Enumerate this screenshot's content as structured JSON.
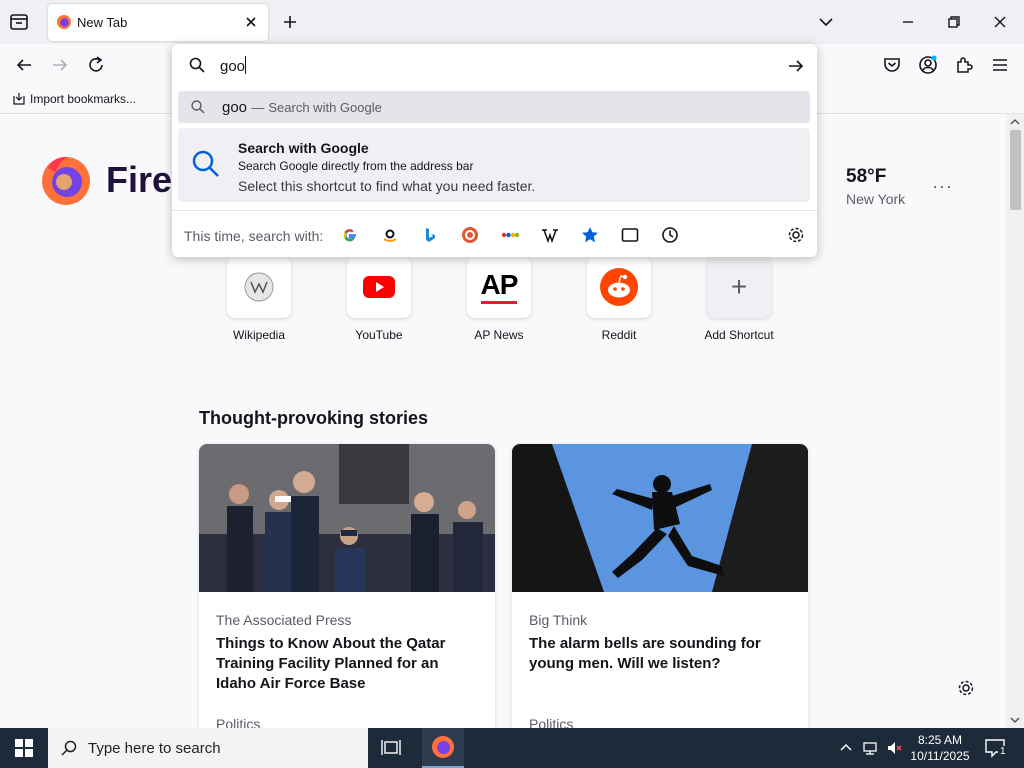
{
  "tabs": [
    {
      "title": "New Tab",
      "active": true
    }
  ],
  "bookmarks": {
    "import_label": "Import bookmarks..."
  },
  "urlbar": {
    "value": "goo",
    "suggestion": {
      "query": "goo",
      "separator": "—",
      "action": "Search with Google"
    },
    "tip": {
      "title": "Search with Google",
      "line1": "Search Google directly from the address bar",
      "line2": "Select this shortcut to find what you need faster."
    },
    "engines_label": "This time, search with:",
    "engines": [
      "google-icon",
      "amazon-icon",
      "bing-icon",
      "duckduckgo-icon",
      "ebay-icon",
      "wikipedia-icon",
      "bookmarks-icon",
      "tabs-icon",
      "history-icon"
    ]
  },
  "brand": {
    "name": "Firef"
  },
  "weather": {
    "temp": "58°F",
    "city": "New York",
    "more": "···"
  },
  "shortcuts": [
    {
      "label": "Wikipedia",
      "icon": "wikipedia-icon"
    },
    {
      "label": "YouTube",
      "icon": "youtube-icon"
    },
    {
      "label": "AP News",
      "icon": "ap-icon",
      "text": "AP"
    },
    {
      "label": "Reddit",
      "icon": "reddit-icon"
    },
    {
      "label": "Add Shortcut",
      "icon": "plus-icon",
      "text": "+"
    }
  ],
  "stories": {
    "section_title": "Thought-provoking stories",
    "items": [
      {
        "source": "The Associated Press",
        "headline": "Things to Know About the Qatar Training Facility Planned for an Idaho Air Force Base",
        "topic": "Politics"
      },
      {
        "source": "Big Think",
        "headline": "The alarm bells are sounding for young men. Will we listen?",
        "topic": "Politics"
      }
    ]
  },
  "taskbar": {
    "search_placeholder": "Type here to search",
    "time": "8:25 AM",
    "date": "10/11/2025",
    "notification_count": "1"
  },
  "colors": {
    "accent": "#0060df",
    "taskbar": "#1d2a3a",
    "firefox_orange": "#ff7139",
    "firefox_purple": "#7542e5"
  }
}
